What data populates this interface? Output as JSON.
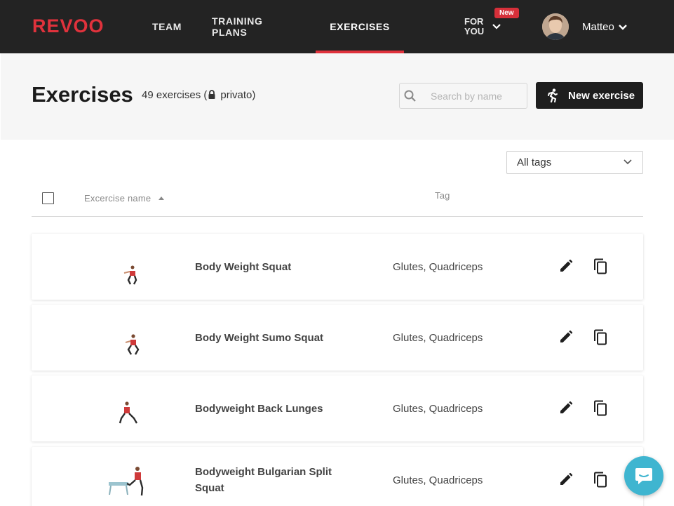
{
  "brand": {
    "logo": "REVOO",
    "accent": "#e0323c"
  },
  "nav": {
    "items": [
      {
        "label": "TEAM",
        "active": false
      },
      {
        "label": "TRAINING PLANS",
        "active": false
      },
      {
        "label": "EXERCISES",
        "active": true
      }
    ],
    "for_you": {
      "line1": "FOR",
      "line2": "YOU",
      "badge": "New"
    },
    "user": {
      "name": "Matteo"
    }
  },
  "header": {
    "title": "Exercises",
    "count_text": "49 exercises (",
    "privacy_text": "privato)",
    "search": {
      "placeholder": "Search by name",
      "value": ""
    },
    "new_button": "New exercise"
  },
  "filter": {
    "tags_selected": "All tags"
  },
  "table": {
    "columns": {
      "name": "Excercise name",
      "tag": "Tag"
    },
    "sort": "ascending",
    "rows": [
      {
        "name": "Body Weight Squat",
        "tags": "Glutes, Quadriceps",
        "thumbnail": "squat-figure"
      },
      {
        "name": "Body Weight Sumo Squat",
        "tags": "Glutes, Quadriceps",
        "thumbnail": "sumo-squat-figure"
      },
      {
        "name": "Bodyweight Back Lunges",
        "tags": "Glutes, Quadriceps",
        "thumbnail": "lunge-figure"
      },
      {
        "name": "Bodyweight Bulgarian Split Squat",
        "tags": "Glutes, Quadriceps",
        "thumbnail": "bulgarian-split-squat-figure"
      }
    ]
  },
  "icons": {
    "search": "search-icon",
    "new": "running-person-icon",
    "edit": "pencil-icon",
    "copy": "copy-icon",
    "chat": "chat-bubble-icon",
    "lock": "lock-icon"
  }
}
